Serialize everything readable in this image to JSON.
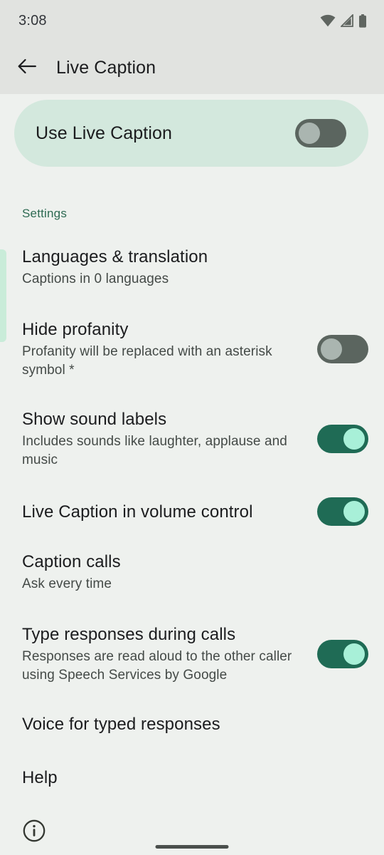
{
  "status_bar": {
    "time": "3:08",
    "icons": [
      "wifi-icon",
      "cell-signal-icon",
      "battery-icon"
    ]
  },
  "app_bar": {
    "back_icon": "arrow-back-icon",
    "title": "Live Caption"
  },
  "hero": {
    "label": "Use Live Caption",
    "toggle_state": "off"
  },
  "section": {
    "header": "Settings"
  },
  "items": [
    {
      "title": "Languages & translation",
      "subtitle": "Captions in 0 languages",
      "toggle": null
    },
    {
      "title": "Hide profanity",
      "subtitle": "Profanity will be replaced with an asterisk symbol *",
      "toggle": "off"
    },
    {
      "title": "Show sound labels",
      "subtitle": "Includes sounds like laughter, applause and music",
      "toggle": "on"
    },
    {
      "title": "Live Caption in volume control",
      "subtitle": "",
      "toggle": "on"
    },
    {
      "title": "Caption calls",
      "subtitle": "Ask every time",
      "toggle": null
    },
    {
      "title": "Type responses during calls",
      "subtitle": "Responses are read aloud to the other caller using Speech Services by Google",
      "toggle": "on"
    },
    {
      "title": "Voice for typed responses",
      "subtitle": "",
      "toggle": null
    },
    {
      "title": "Help",
      "subtitle": "",
      "toggle": null
    }
  ],
  "footer": {
    "info_icon": "info-circle-icon"
  },
  "colors": {
    "app_bar_bg": "#e1e3e0",
    "page_bg": "#eef1ee",
    "card_bg": "#d3e8dd",
    "accent_green": "#2d6a52",
    "toggle_on_track": "#1f6b55",
    "toggle_on_knob": "#a8f0d8",
    "toggle_off_track": "#5b655f",
    "toggle_off_knob": "#aab5b0",
    "scroll_indicator": "#c9ecd9",
    "text_primary": "#1b1c1e",
    "text_secondary": "#444a47"
  }
}
